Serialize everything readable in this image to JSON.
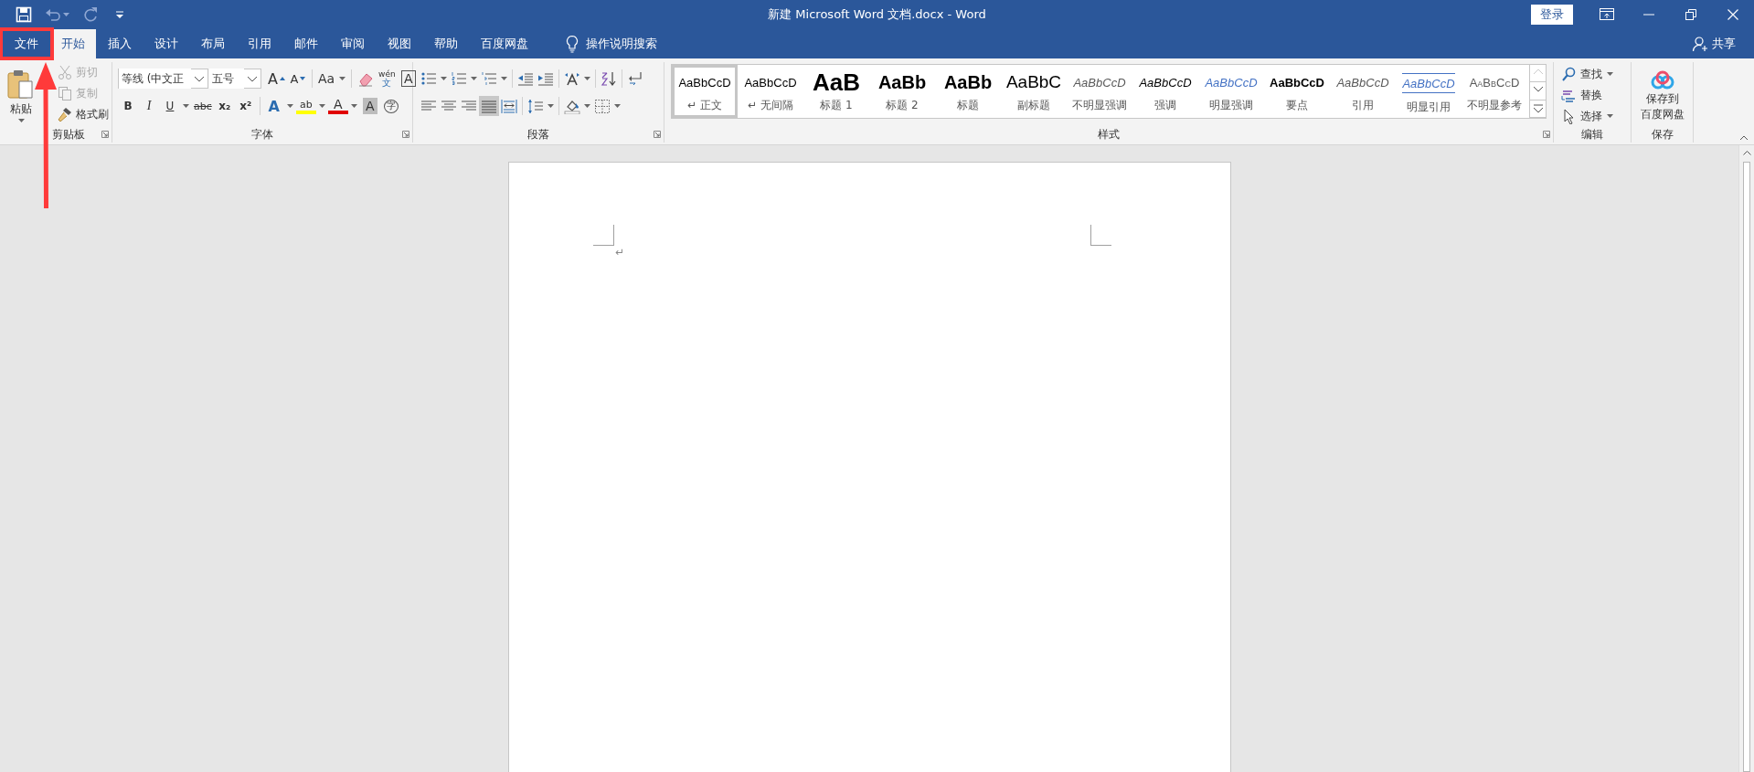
{
  "window": {
    "title": "新建 Microsoft Word 文档.docx - Word",
    "sign_in": "登录"
  },
  "quick_access": [
    {
      "kind": "save",
      "disabled": false,
      "menu": false
    },
    {
      "kind": "undo",
      "disabled": true,
      "menu": true
    },
    {
      "kind": "redo",
      "disabled": true,
      "menu": false
    },
    {
      "kind": "customize",
      "disabled": false,
      "menu": false
    }
  ],
  "tabs": [
    {
      "label": "文件",
      "selected": false,
      "marked": true
    },
    {
      "label": "开始",
      "selected": true,
      "marked": false
    },
    {
      "label": "插入",
      "selected": false,
      "marked": false
    },
    {
      "label": "设计",
      "selected": false,
      "marked": false
    },
    {
      "label": "布局",
      "selected": false,
      "marked": false
    },
    {
      "label": "引用",
      "selected": false,
      "marked": false
    },
    {
      "label": "邮件",
      "selected": false,
      "marked": false
    },
    {
      "label": "审阅",
      "selected": false,
      "marked": false
    },
    {
      "label": "视图",
      "selected": false,
      "marked": false
    },
    {
      "label": "帮助",
      "selected": false,
      "marked": false
    },
    {
      "label": "百度网盘",
      "selected": false,
      "marked": false
    }
  ],
  "tell_me": "操作说明搜索",
  "share": "共享",
  "clipboard": {
    "label": "剪贴板",
    "paste": "粘贴",
    "items": [
      {
        "kind": "cut",
        "label": "剪切",
        "disabled": true
      },
      {
        "kind": "copy",
        "label": "复制",
        "disabled": true
      },
      {
        "kind": "format-painter",
        "label": "格式刷",
        "disabled": false
      }
    ]
  },
  "font": {
    "label": "字体",
    "name": "等线 (中文正",
    "size": "五号",
    "row_1": [
      {
        "kind": "grow",
        "glyph": "A",
        "menu": false
      },
      {
        "kind": "shrink",
        "glyph": "A",
        "menu": false
      },
      {
        "kind": "case",
        "glyph": "Aa",
        "menu": true
      },
      {
        "kind": "clear",
        "menu": false
      },
      {
        "kind": "phonetic",
        "glyph": "wén",
        "sub": "文",
        "menu": false
      },
      {
        "kind": "border",
        "glyph": "A",
        "menu": false
      }
    ],
    "row_2": [
      {
        "kind": "bold",
        "glyph": "B",
        "menu": false
      },
      {
        "kind": "italic",
        "glyph": "I",
        "menu": false
      },
      {
        "kind": "underline",
        "glyph": "U",
        "menu": true
      },
      {
        "kind": "strike",
        "glyph": "abc",
        "menu": false
      },
      {
        "kind": "subscript",
        "glyph": "x₂",
        "menu": false
      },
      {
        "kind": "superscript",
        "glyph": "x²",
        "menu": false
      },
      {
        "kind": "text-effect",
        "glyph": "A",
        "menu": true
      },
      {
        "kind": "highlight",
        "glyph": "ab",
        "menu": true
      },
      {
        "kind": "font-color",
        "glyph": "A",
        "menu": true
      },
      {
        "kind": "shading",
        "glyph": "A",
        "menu": false
      },
      {
        "kind": "enclose",
        "glyph": "字",
        "menu": false
      }
    ]
  },
  "paragraph": {
    "label": "段落",
    "row_1": [
      {
        "kind": "bullets",
        "menu": true
      },
      {
        "kind": "numbering",
        "menu": true
      },
      {
        "kind": "multilevel",
        "menu": true
      },
      {
        "kind": "decrease-indent",
        "menu": false
      },
      {
        "kind": "increase-indent",
        "menu": false
      },
      {
        "kind": "asian-layout",
        "menu": true
      },
      {
        "kind": "sort",
        "menu": false
      },
      {
        "kind": "show-marks",
        "menu": false
      }
    ],
    "alignment": [
      {
        "kind": "left",
        "selected": false
      },
      {
        "kind": "center",
        "selected": false
      },
      {
        "kind": "right",
        "selected": false
      },
      {
        "kind": "justify",
        "selected": true
      },
      {
        "kind": "distributed",
        "selected": false
      }
    ],
    "row_2": [
      {
        "kind": "line-spacing",
        "menu": true
      },
      {
        "kind": "shading",
        "menu": true
      },
      {
        "kind": "borders",
        "menu": true
      }
    ]
  },
  "styles": {
    "label": "样式",
    "items": [
      {
        "kind": "normal",
        "preview": "AaBbCcD",
        "name": "↵ 正文",
        "selected": true
      },
      {
        "kind": "normal",
        "preview": "AaBbCcD",
        "name": "↵ 无间隔",
        "selected": false
      },
      {
        "kind": "heading-1",
        "preview": "AaB",
        "name": "标题 1",
        "selected": false
      },
      {
        "kind": "heading-2",
        "preview": "AaBb",
        "name": "标题 2",
        "selected": false
      },
      {
        "kind": "heading-2",
        "preview": "AaBb",
        "name": "标题",
        "selected": false
      },
      {
        "kind": "subtitle",
        "preview": "AaBbC",
        "name": "副标题",
        "selected": false
      },
      {
        "kind": "subtle-emphasis",
        "preview": "AaBbCcD",
        "name": "不明显强调",
        "selected": false
      },
      {
        "kind": "emphasis",
        "preview": "AaBbCcD",
        "name": "强调",
        "selected": false
      },
      {
        "kind": "intense-emphasis",
        "preview": "AaBbCcD",
        "name": "明显强调",
        "selected": false
      },
      {
        "kind": "strong",
        "preview": "AaBbCcD",
        "name": "要点",
        "selected": false
      },
      {
        "kind": "subtle-emphasis",
        "preview": "AaBbCcD",
        "name": "引用",
        "selected": false
      },
      {
        "kind": "intense-quote",
        "preview": "AaBbCcD",
        "name": "明显引用",
        "selected": false
      },
      {
        "kind": "subtle-reference",
        "preview": "AaBbCcD",
        "name": "不明显参考",
        "selected": false
      }
    ]
  },
  "editing": {
    "label": "编辑",
    "items": [
      {
        "kind": "find",
        "label": "查找",
        "menu": true
      },
      {
        "kind": "replace",
        "label": "替换",
        "menu": false
      },
      {
        "kind": "select",
        "label": "选择",
        "menu": true
      }
    ]
  },
  "save": {
    "label": "保存",
    "lines": [
      "保存到",
      "百度网盘"
    ]
  },
  "document": {
    "paragraph_mark": "↵"
  }
}
